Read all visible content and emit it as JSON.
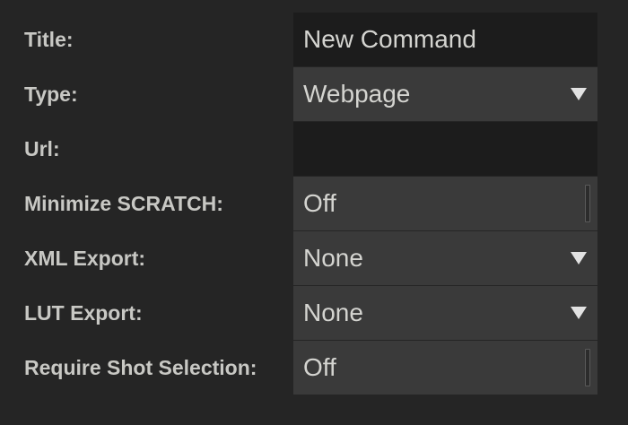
{
  "form": {
    "title": {
      "label": "Title:",
      "value": "New Command"
    },
    "type": {
      "label": "Type:",
      "value": "Webpage",
      "icon": "chevron-down-icon"
    },
    "url": {
      "label": "Url:",
      "value": ""
    },
    "minimize_scratch": {
      "label": "Minimize SCRATCH:",
      "value": "Off"
    },
    "xml_export": {
      "label": "XML Export:",
      "value": "None",
      "icon": "chevron-down-icon"
    },
    "lut_export": {
      "label": "LUT Export:",
      "value": "None",
      "icon": "chevron-down-icon"
    },
    "require_shot_selection": {
      "label": "Require Shot Selection:",
      "value": "Off"
    }
  },
  "colors": {
    "background": "#252525",
    "text_field_bg": "#1c1c1c",
    "select_field_bg": "#3a3a3a",
    "label_text": "#c8c8c4",
    "value_text": "#d4d4d0"
  }
}
